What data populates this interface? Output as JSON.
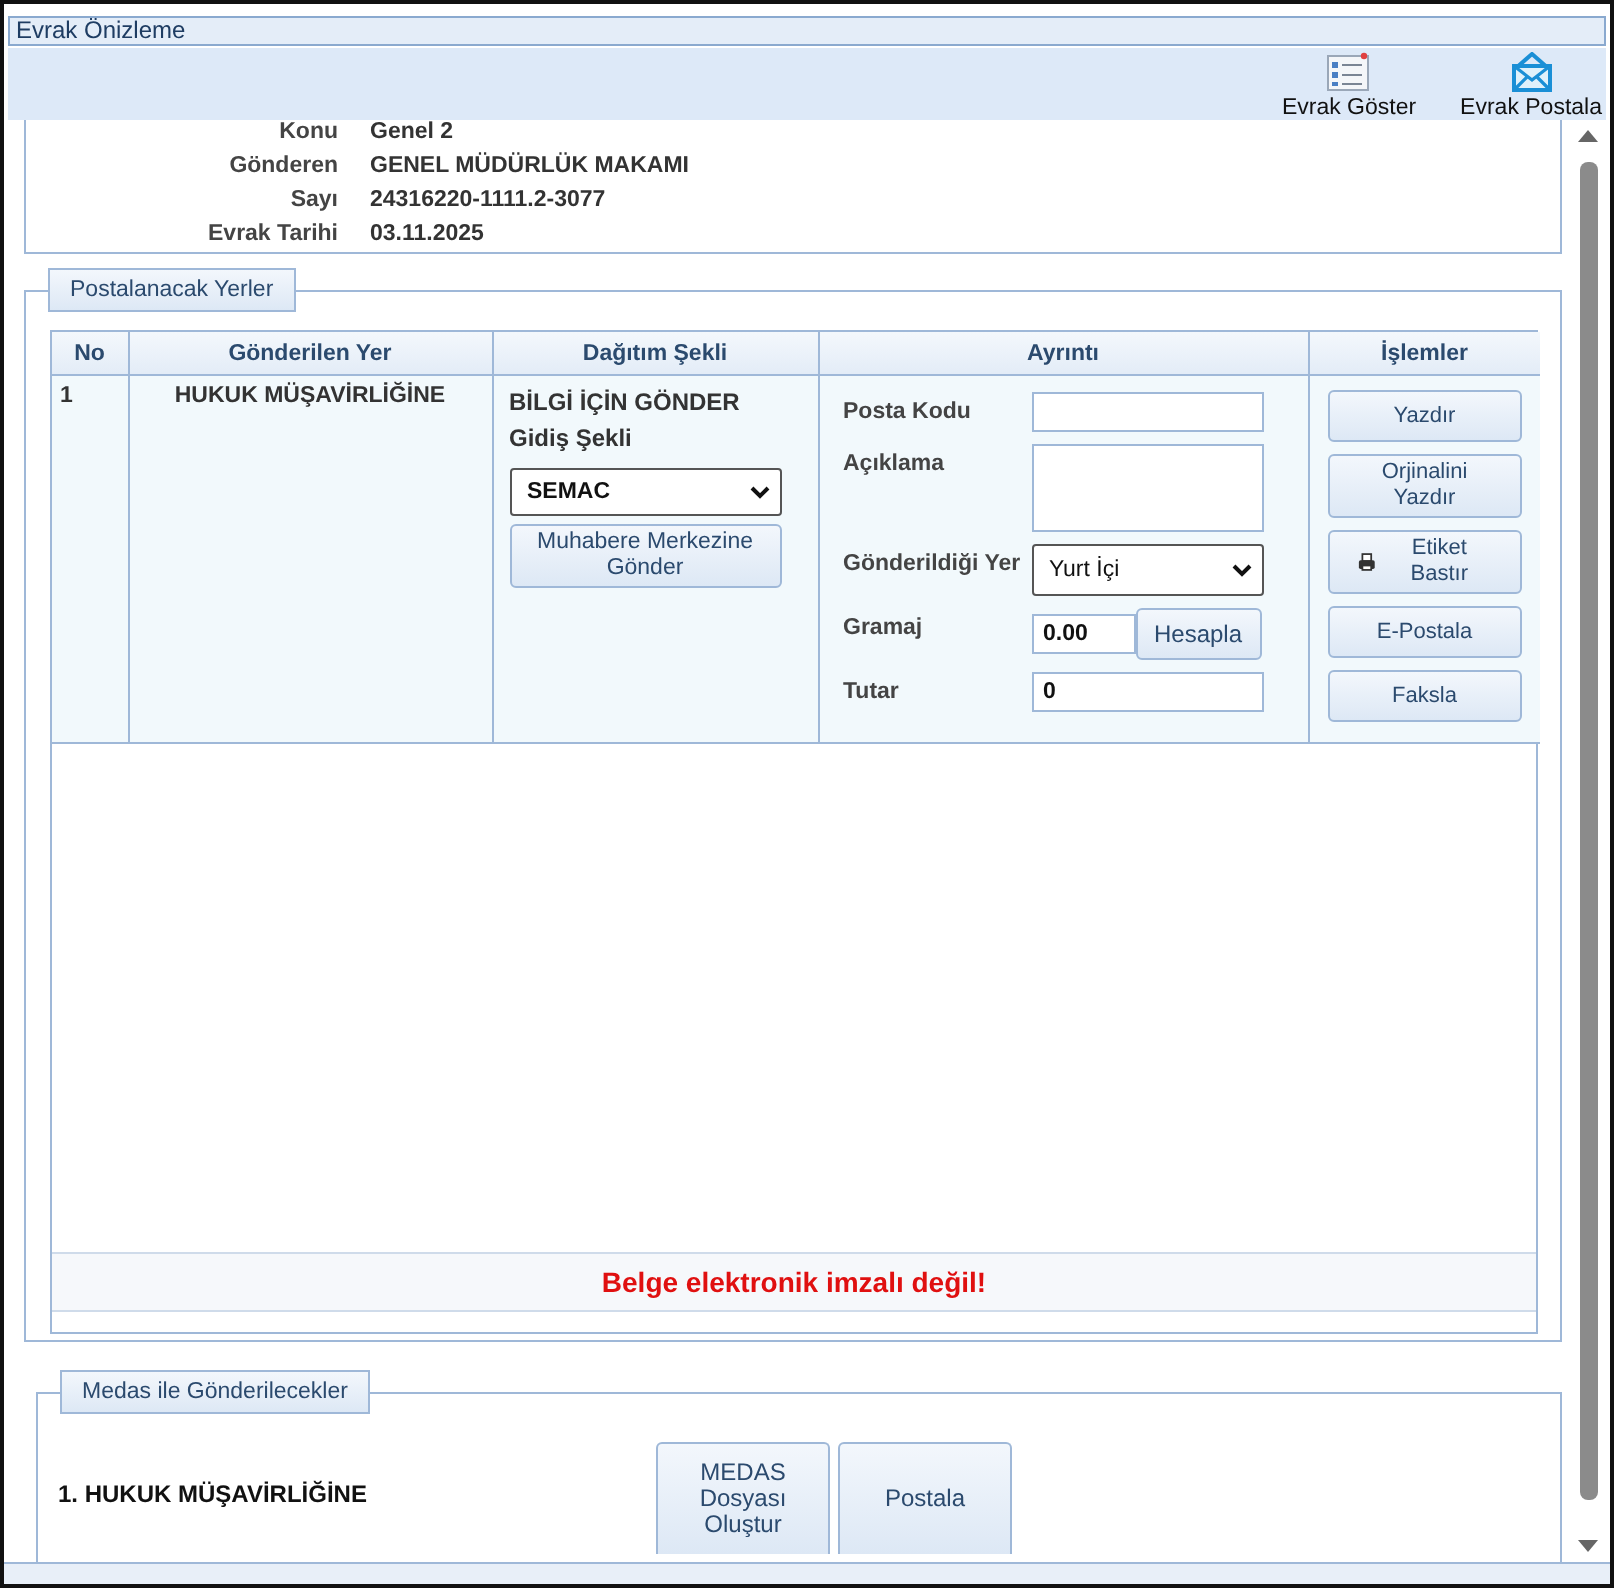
{
  "window": {
    "title": "Evrak Önizleme"
  },
  "toolbar": [
    {
      "kind": "list",
      "label": "Evrak Göster"
    },
    {
      "kind": "mail",
      "label": "Evrak Postala"
    }
  ],
  "details": [
    {
      "label": "Konu",
      "value": "Genel 2"
    },
    {
      "label": "Gönderen",
      "value": "GENEL MÜDÜRLÜK MAKAMI"
    },
    {
      "label": "Sayı",
      "value": "24316220-1111.2-3077"
    },
    {
      "label": "Evrak Tarihi",
      "value": "03.11.2025"
    }
  ],
  "postal_section": {
    "legend": "Postalanacak Yerler",
    "columns": [
      "No",
      "Gönderilen Yer",
      "Dağıtım Şekli",
      "Ayrıntı",
      "İşlemler"
    ],
    "rows": [
      {
        "no": "1",
        "recipient": "HUKUK MÜŞAVİRLİĞİNE",
        "distribution": "BİLGİ İÇİN GÖNDER",
        "route_label": "Gidiş Şekli",
        "route_value": "SEMAC",
        "send_button": "Muhabere Merkezine Gönder",
        "fields": [
          {
            "kind": "text",
            "label": "Posta Kodu"
          },
          {
            "kind": "textarea",
            "label": "Açıklama"
          },
          {
            "kind": "select",
            "label": "Gönderildiği Yer",
            "value": "Yurt İçi"
          },
          {
            "kind": "calc",
            "label": "Gramaj",
            "value": "0.00",
            "button": "Hesapla"
          },
          {
            "kind": "text",
            "label": "Tutar",
            "value": "0"
          }
        ],
        "actions": [
          {
            "kind": "plain",
            "label": "Yazdır"
          },
          {
            "kind": "plain",
            "label": "Orjinalini Yazdır"
          },
          {
            "kind": "printer",
            "label": "Etiket Bastır"
          },
          {
            "kind": "plain",
            "label": "E-Postala"
          },
          {
            "kind": "plain",
            "label": "Faksla"
          }
        ]
      }
    ],
    "warning": "Belge elektronik imzalı değil!"
  },
  "medas_section": {
    "legend": "Medas ile Gönderilecekler",
    "items": [
      "1. HUKUK MÜŞAVİRLİĞİNE"
    ],
    "buttons": [
      "MEDAS Dosyası Oluştur",
      "Postala"
    ]
  }
}
